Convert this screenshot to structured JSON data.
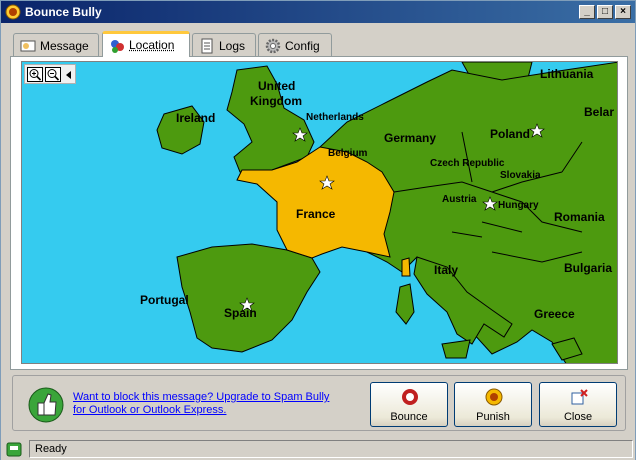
{
  "window": {
    "title": "Bounce Bully"
  },
  "title_buttons": {
    "minimize": "_",
    "maximize": "□",
    "close": "×"
  },
  "tabs": [
    {
      "label": "Message",
      "icon": "message-icon",
      "active": false
    },
    {
      "label": "Location",
      "icon": "location-icon",
      "active": true
    },
    {
      "label": "Logs",
      "icon": "logs-icon",
      "active": false
    },
    {
      "label": "Config",
      "icon": "gear-icon",
      "active": false
    }
  ],
  "map": {
    "zoom_controls": [
      "zoom-in-icon",
      "zoom-out-icon"
    ],
    "highlighted_country": "France",
    "labels": {
      "lithuania": "Lithuania",
      "belarus": "Belar",
      "united_kingdom_1": "United",
      "united_kingdom_2": "Kingdom",
      "ireland": "Ireland",
      "netherlands": "Netherlands",
      "belgium": "Belgium",
      "germany": "Germany",
      "poland": "Poland",
      "czech": "Czech Republic",
      "slovakia": "Slovakia",
      "austria": "Austria",
      "hungary": "Hungary",
      "romania": "Romania",
      "france": "France",
      "italy": "Italy",
      "bulgaria": "Bulgaria",
      "portugal": "Portugal",
      "spain": "Spain",
      "greece": "Greece"
    },
    "colors": {
      "sea": "#35cbef",
      "land": "#4d9a0f",
      "highlight": "#f5b800"
    }
  },
  "promo": {
    "text": "Want to block this message? Upgrade to Spam Bully for Outlook or Outlook Express."
  },
  "actions": [
    {
      "label": "Bounce",
      "icon": "bounce-icon"
    },
    {
      "label": "Punish",
      "icon": "punish-icon"
    },
    {
      "label": "Close",
      "icon": "close-icon"
    }
  ],
  "status": {
    "text": "Ready"
  }
}
